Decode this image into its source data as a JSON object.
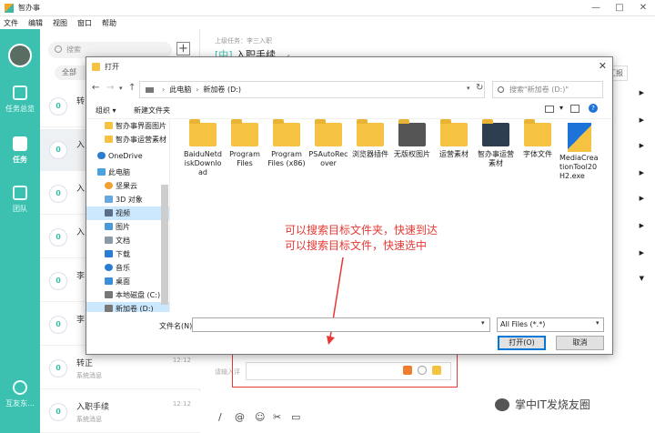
{
  "app": {
    "title": "智办事",
    "window_buttons": [
      "—",
      "□",
      "✕"
    ]
  },
  "menu": [
    "文件",
    "编辑",
    "视图",
    "窗口",
    "帮助"
  ],
  "nav": {
    "items": [
      {
        "label": "任务总览",
        "icon": "checklist-icon"
      },
      {
        "label": "任务",
        "icon": "task-icon",
        "active": true
      },
      {
        "label": "团队",
        "icon": "team-icon"
      }
    ],
    "bottom_label": "互友东..."
  },
  "list": {
    "search_placeholder": "搜索",
    "add_label": "+",
    "filter_label": "全部",
    "tasks": [
      {
        "count": "0",
        "title": "转",
        "sub": "",
        "time": ""
      },
      {
        "count": "0",
        "title": "入",
        "sub": "",
        "time": ""
      },
      {
        "count": "0",
        "title": "入",
        "sub": "",
        "time": ""
      },
      {
        "count": "0",
        "title": "入",
        "sub": "",
        "time": ""
      },
      {
        "count": "0",
        "title": "李",
        "sub": "",
        "time": ""
      },
      {
        "count": "0",
        "title": "李",
        "sub": "",
        "time": ""
      },
      {
        "count": "0",
        "title": "转正",
        "sub": "系统消息",
        "time": "12:12"
      },
      {
        "count": "0",
        "title": "入职手续",
        "sub": "系统消息",
        "time": "12:12"
      }
    ]
  },
  "detail": {
    "parent_label": "上级任务：李三入职",
    "tag": "[中]",
    "title": "入职手续",
    "report_button": "直看汇报",
    "comment_placeholder": "请输入评",
    "toolbar": [
      "/",
      "@",
      "☺",
      "✂",
      "▭"
    ]
  },
  "dialog": {
    "title": "打开",
    "path": [
      "此电脑",
      "新加卷 (D:)"
    ],
    "search_placeholder": "搜索\"新加卷 (D:)\"",
    "organize": "组织 ▾",
    "new_folder": "新建文件夹",
    "tree": [
      {
        "label": "智办事界面图片",
        "icon": "folder-icon"
      },
      {
        "label": "智办事运营素材",
        "icon": "folder-icon"
      },
      {
        "label": "OneDrive",
        "icon": "cloud-icon"
      },
      {
        "label": "此电脑",
        "icon": "computer-icon"
      },
      {
        "label": "坚果云",
        "icon": "nut-cloud-icon"
      },
      {
        "label": "3D 对象",
        "icon": "cube-icon"
      },
      {
        "label": "视频",
        "icon": "video-icon",
        "selected": true
      },
      {
        "label": "图片",
        "icon": "picture-icon"
      },
      {
        "label": "文档",
        "icon": "document-icon"
      },
      {
        "label": "下载",
        "icon": "download-icon"
      },
      {
        "label": "音乐",
        "icon": "music-icon"
      },
      {
        "label": "桌面",
        "icon": "desktop-icon"
      },
      {
        "label": "本地磁盘 (C:)",
        "icon": "drive-icon"
      },
      {
        "label": "新加卷 (D:)",
        "icon": "drive-icon"
      }
    ],
    "files": [
      {
        "name": "BaiduNetdiskDownload",
        "kind": "folder"
      },
      {
        "name": "Program Files",
        "kind": "folder"
      },
      {
        "name": "Program Files (x86)",
        "kind": "folder"
      },
      {
        "name": "PSAutoRecover",
        "kind": "folder"
      },
      {
        "name": "浏览器插件",
        "kind": "folder"
      },
      {
        "name": "无版权图片",
        "kind": "folder"
      },
      {
        "name": "运营素材",
        "kind": "folder"
      },
      {
        "name": "智办事运营素材",
        "kind": "folder"
      },
      {
        "name": "字体文件",
        "kind": "folder"
      },
      {
        "name": "MediaCreationTool20H2.exe",
        "kind": "exe"
      }
    ],
    "filename_label": "文件名(N):",
    "filter_value": "All Files (*.*)",
    "open_button": "打开(O)",
    "cancel_button": "取消"
  },
  "annotation": {
    "line1": "可以搜索目标文件夹，快速到达",
    "line2": "可以搜索目标文件，快速选中",
    "color": "#e53935"
  },
  "watermark": "掌中IT发烧友圈",
  "colors": {
    "accent": "#3cc0b0",
    "folder": "#f5c242"
  }
}
